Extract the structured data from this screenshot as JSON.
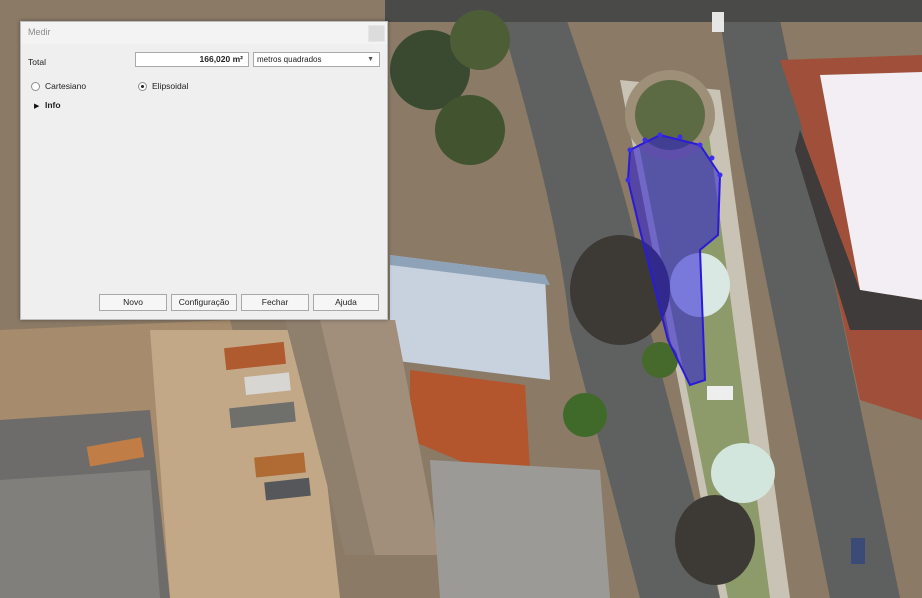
{
  "dialog": {
    "title": "Medir",
    "total_label": "Total",
    "total_value": "166,020 m²",
    "unit_selected": "metros quadrados",
    "radio_cartesian": "Cartesiano",
    "radio_ellipsoidal": "Elipsoidal",
    "info_label": "Info",
    "buttons": {
      "new": "Novo",
      "settings": "Configuração",
      "close": "Fechar",
      "help": "Ajuda"
    }
  },
  "colors": {
    "measure_polygon": "#2a1bd6",
    "dialog_bg": "#efefef"
  },
  "icons": {
    "expand": "triangle-right-icon",
    "dropdown": "chevron-down-icon"
  }
}
